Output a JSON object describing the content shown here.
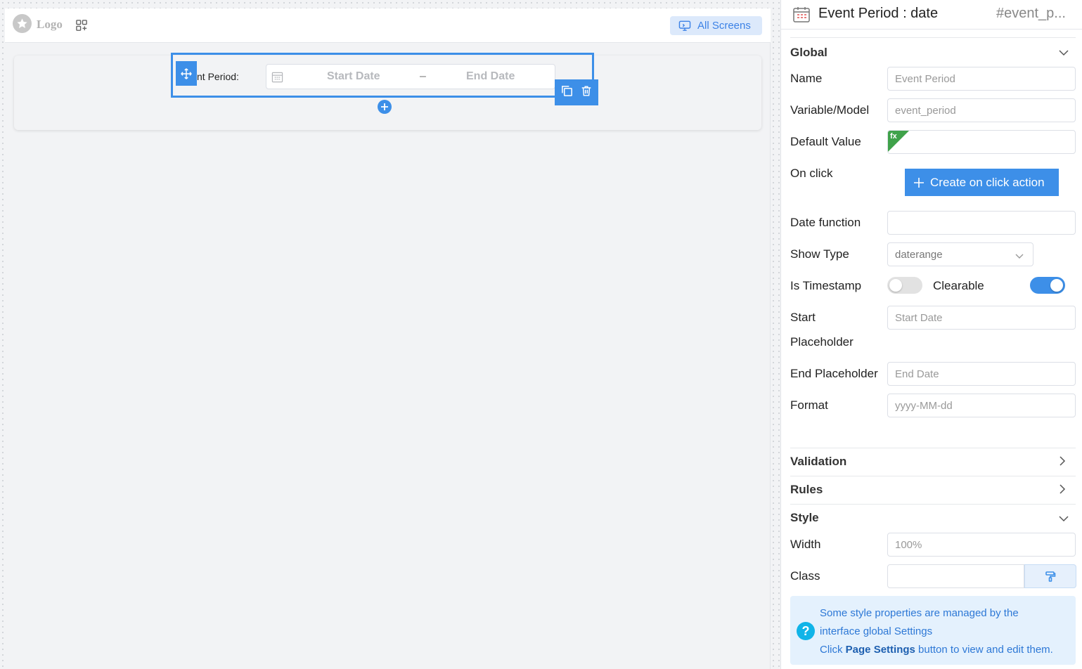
{
  "canvas": {
    "logo_text": "Logo",
    "all_screens_label": "All Screens",
    "field_label": "nt Period:",
    "start_placeholder": "Start Date",
    "separator": "–",
    "end_placeholder": "End Date"
  },
  "panel": {
    "title": "Event Period : date",
    "component_id": "#event_p...",
    "sections": {
      "global": "Global",
      "validation": "Validation",
      "rules": "Rules",
      "style": "Style"
    },
    "props": {
      "name_label": "Name",
      "name_value": "Event Period",
      "variable_label": "Variable/Model",
      "variable_value": "event_period",
      "default_label": "Default Value",
      "default_badge": "fx",
      "onclick_label": "On click",
      "create_action_label": "Create on click action",
      "date_function_label": "Date function",
      "show_type_label": "Show Type",
      "show_type_value": "daterange",
      "is_timestamp_label": "Is Timestamp",
      "clearable_label": "Clearable",
      "start_label_1": "Start",
      "start_label_2": "Placeholder",
      "start_value": "Start Date",
      "end_label": "End Placeholder",
      "end_value": "End Date",
      "format_label": "Format",
      "format_value": "yyyy-MM-dd"
    },
    "style": {
      "width_label": "Width",
      "width_value": "100%",
      "class_label": "Class"
    },
    "info": {
      "line1": "Some style properties are managed by the",
      "line2": "interface global Settings",
      "line3_pre": "Click ",
      "line3_bold": "Page Settings",
      "line3_post": " button to view and edit them."
    },
    "toggles": {
      "is_timestamp": false,
      "clearable": true
    },
    "colors": {
      "accent": "#3d8fe8",
      "toggle_off": "#e2e2e2",
      "fx_green": "#3fa24a"
    }
  }
}
